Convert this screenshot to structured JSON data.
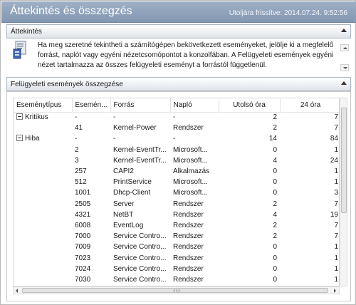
{
  "header": {
    "title": "Áttekintés és összegzés",
    "refresh_text": "Utoljára frissítve: 2014.07.24. 9:52:56"
  },
  "overview": {
    "section_label": "Áttekintés",
    "text": "Ha meg szeretné tekintheti a számítógépen bekövetkezett eseményeket, jelölje ki a megfelelő forrást, naplót vagy egyéni nézetcsomópontot a konzolfában. A Felügyeleti események egyéni nézet tartalmazza az összes felügyeleti eseményt a forrástól függetlenül.",
    "icon": "info-document-icon"
  },
  "summary": {
    "section_label": "Felügyeleti események összegzése",
    "columns": [
      "Eseménytípus",
      "Esemén...",
      "Forrás",
      "Napló",
      "Utolsó óra",
      "24 óra"
    ],
    "rows": [
      {
        "type": "Kritikus",
        "group": true,
        "id": "-",
        "source": "-",
        "log": "-",
        "last_hour": "2",
        "day": "7"
      },
      {
        "type": "",
        "group": false,
        "id": "41",
        "source": "Kernel-Power",
        "log": "Rendszer",
        "last_hour": "2",
        "day": "7"
      },
      {
        "type": "Hiba",
        "group": true,
        "id": "-",
        "source": "-",
        "log": "-",
        "last_hour": "14",
        "day": "84"
      },
      {
        "type": "",
        "group": false,
        "id": "2",
        "source": "Kernel-EventTr...",
        "log": "Microsoft...",
        "last_hour": "0",
        "day": "1"
      },
      {
        "type": "",
        "group": false,
        "id": "3",
        "source": "Kernel-EventTr...",
        "log": "Microsoft...",
        "last_hour": "4",
        "day": "24"
      },
      {
        "type": "",
        "group": false,
        "id": "257",
        "source": "CAPI2",
        "log": "Alkalmazás",
        "last_hour": "0",
        "day": "1"
      },
      {
        "type": "",
        "group": false,
        "id": "512",
        "source": "PrintService",
        "log": "Microsoft...",
        "last_hour": "0",
        "day": "1"
      },
      {
        "type": "",
        "group": false,
        "id": "1001",
        "source": "Dhcp-Client",
        "log": "Microsoft...",
        "last_hour": "0",
        "day": "3"
      },
      {
        "type": "",
        "group": false,
        "id": "2505",
        "source": "Server",
        "log": "Rendszer",
        "last_hour": "2",
        "day": "7"
      },
      {
        "type": "",
        "group": false,
        "id": "4321",
        "source": "NetBT",
        "log": "Rendszer",
        "last_hour": "4",
        "day": "19"
      },
      {
        "type": "",
        "group": false,
        "id": "6008",
        "source": "EventLog",
        "log": "Rendszer",
        "last_hour": "2",
        "day": "7"
      },
      {
        "type": "",
        "group": false,
        "id": "7000",
        "source": "Service Contro...",
        "log": "Rendszer",
        "last_hour": "2",
        "day": "7"
      },
      {
        "type": "",
        "group": false,
        "id": "7009",
        "source": "Service Contro...",
        "log": "Rendszer",
        "last_hour": "0",
        "day": "1"
      },
      {
        "type": "",
        "group": false,
        "id": "7023",
        "source": "Service Contro...",
        "log": "Rendszer",
        "last_hour": "0",
        "day": "1"
      },
      {
        "type": "",
        "group": false,
        "id": "7024",
        "source": "Service Contro...",
        "log": "Rendszer",
        "last_hour": "0",
        "day": "1"
      },
      {
        "type": "",
        "group": false,
        "id": "7030",
        "source": "Service Contro...",
        "log": "Rendszer",
        "last_hour": "0",
        "day": "1"
      }
    ]
  },
  "colors": {
    "header_bg": "#8fa1bb",
    "header_text": "#ffffff",
    "section_bar_bg": "#e6eaef"
  }
}
